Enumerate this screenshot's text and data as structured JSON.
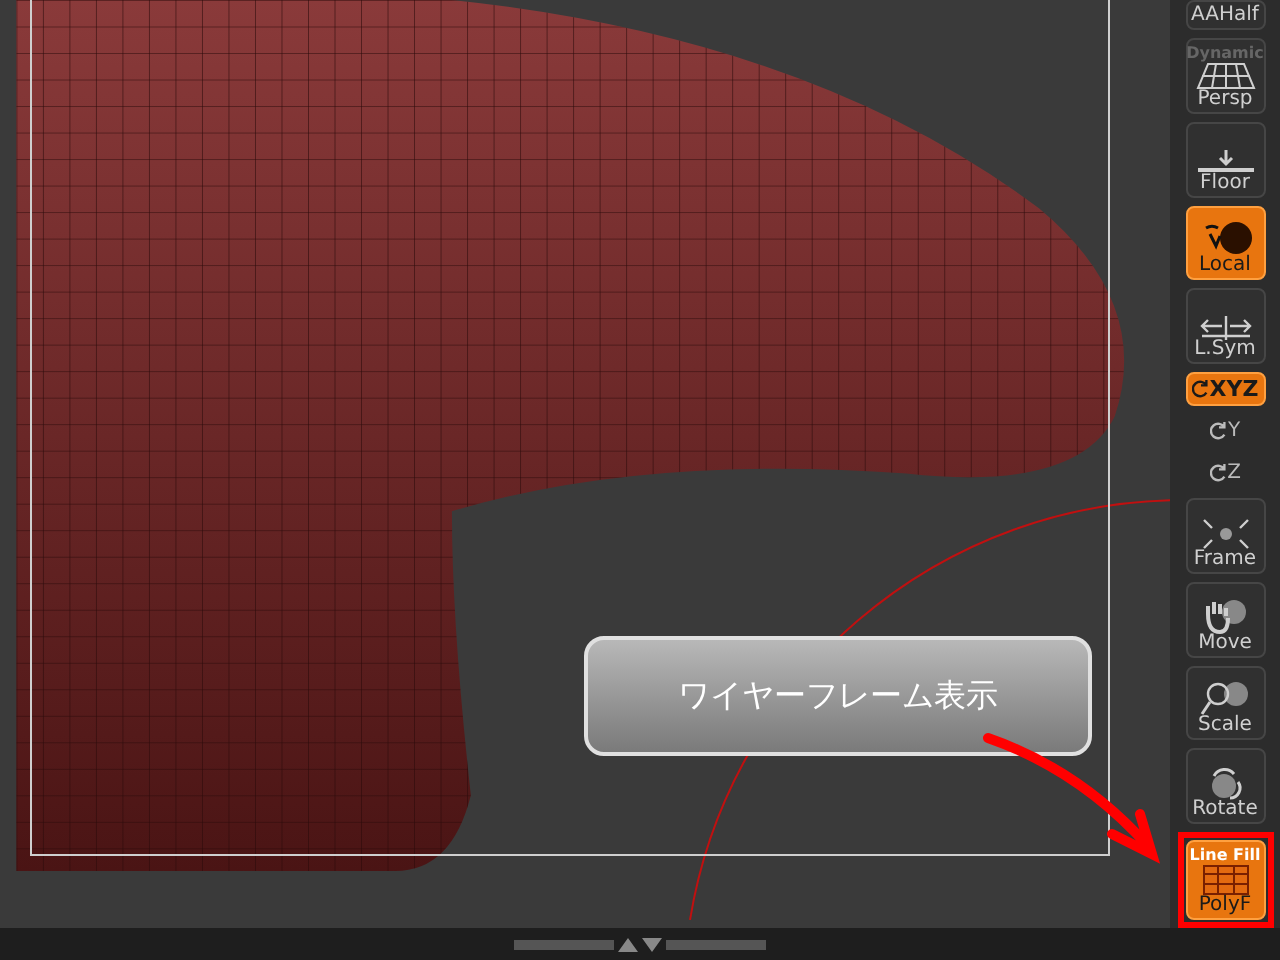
{
  "callout": {
    "text": "ワイヤーフレーム表示"
  },
  "toolbar": {
    "buttons": [
      {
        "kind": "plain",
        "label": "AAHalf",
        "on": false,
        "highlighted": false
      },
      {
        "kind": "persp",
        "top_label": "Dynamic",
        "label": "Persp",
        "on": false,
        "highlighted": false
      },
      {
        "kind": "floor",
        "label": "Floor",
        "on": false,
        "highlighted": false
      },
      {
        "kind": "local",
        "label": "Local",
        "on": true,
        "highlighted": false
      },
      {
        "kind": "lsym",
        "label": "L.Sym",
        "on": false,
        "highlighted": false
      },
      {
        "kind": "xyz",
        "label": "XYZ",
        "on": true,
        "highlighted": false
      },
      {
        "kind": "axis",
        "label": "Y",
        "on": false,
        "highlighted": false
      },
      {
        "kind": "axis",
        "label": "Z",
        "on": false,
        "highlighted": false
      },
      {
        "kind": "frame",
        "label": "Frame",
        "on": false,
        "highlighted": false
      },
      {
        "kind": "move",
        "label": "Move",
        "on": false,
        "highlighted": false
      },
      {
        "kind": "scale",
        "label": "Scale",
        "on": false,
        "highlighted": false
      },
      {
        "kind": "rotate",
        "label": "Rotate",
        "on": false,
        "highlighted": false
      },
      {
        "kind": "polyf",
        "top_label": "Line Fill",
        "label": "PolyF",
        "on": true,
        "highlighted": true
      }
    ]
  }
}
